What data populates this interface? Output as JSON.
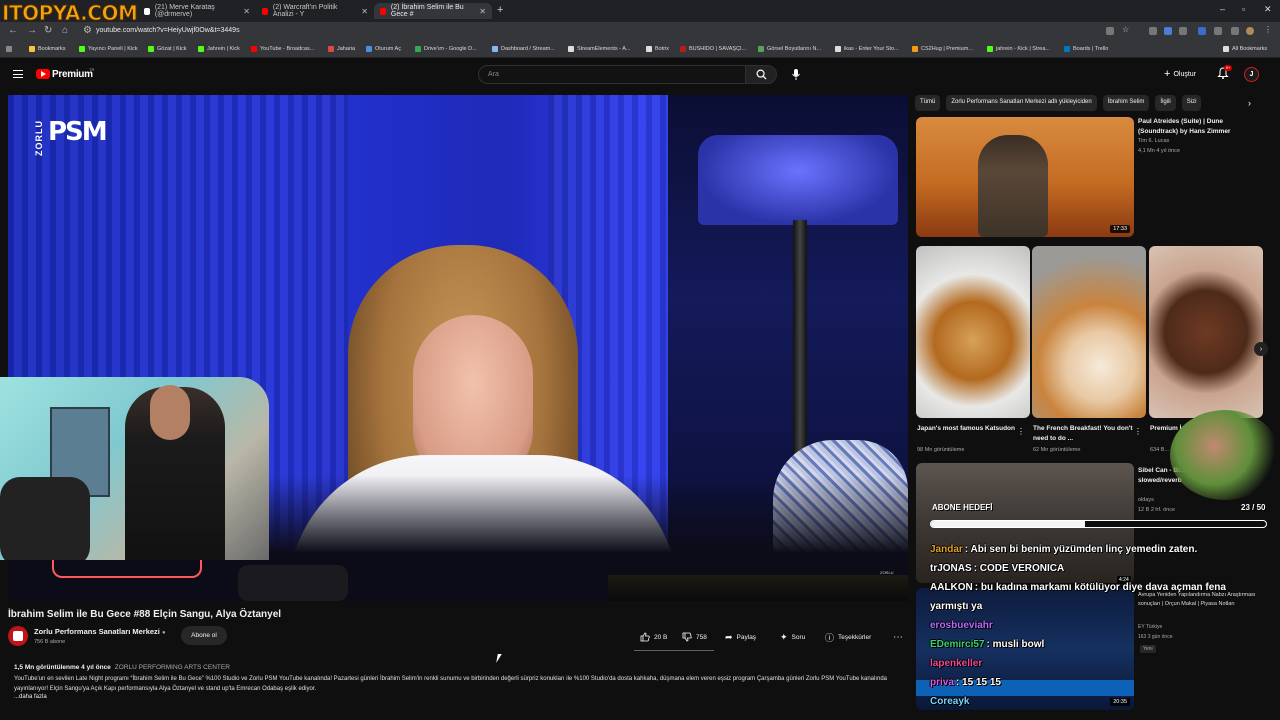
{
  "browser": {
    "logo_text": "ITOPYA.COM",
    "tabs": [
      {
        "label": "(21) Merve Karataş (@drmerve)",
        "color": "#ffffff",
        "active": false
      },
      {
        "label": "(2) Warcraft'ın Politik Analizi - Y",
        "color": "#ff0000",
        "active": false
      },
      {
        "label": "(2) İbrahim Selim ile Bu Gece #",
        "color": "#ff0000",
        "active": true
      }
    ],
    "url": "youtube.com/watch?v=HeiyUwjf0Ow&t=3449s",
    "bookmarks": [
      {
        "label": "Bookmarks",
        "color": "#f5c542"
      },
      {
        "label": "Yayıncı Paneli | Kick",
        "color": "#53fc18"
      },
      {
        "label": "Gözat | Kick",
        "color": "#53fc18"
      },
      {
        "label": "Jahrein | Kick",
        "color": "#53fc18"
      },
      {
        "label": "YouTube - Broadcas...",
        "color": "#ff0000"
      },
      {
        "label": "Jaharia",
        "color": "#e04848"
      },
      {
        "label": "Oturum Aç",
        "color": "#4a90e2"
      },
      {
        "label": "Drive'ım - Google D...",
        "color": "#34a853"
      },
      {
        "label": "Dashboard / Stream...",
        "color": "#8ab4f8"
      },
      {
        "label": "StreamElements - A...",
        "color": "#dddddd"
      },
      {
        "label": "Botrix",
        "color": "#dddddd"
      },
      {
        "label": "BUSHIDO | SAVAŞÇI...",
        "color": "#b71c1c"
      },
      {
        "label": "Görsel Boyutlarını N...",
        "color": "#5aa05a"
      },
      {
        "label": "ikas - Enter Your Sto...",
        "color": "#dddddd"
      },
      {
        "label": "CS2Hug | Premium...",
        "color": "#f39c12"
      },
      {
        "label": "jahrein - Kick | Strea...",
        "color": "#53fc18"
      },
      {
        "label": "Boards | Trello",
        "color": "#0079bf"
      },
      {
        "label": "All Bookmarks",
        "color": "#dddddd"
      }
    ]
  },
  "header": {
    "logo": "Premium",
    "logo_sup": "TR",
    "search_placeholder": "Ara",
    "create_label": "Oluştur",
    "notification_count": "9+",
    "avatar_letter": "J"
  },
  "video": {
    "brand_top": "ZORLU",
    "brand_main": "PSM",
    "watermark": "ZORLU",
    "title": "İbrahim Selim ile Bu Gece #88 Elçin Sangu, Alya Öztanyel",
    "channel": "Zorlu Performans Sanatları Merkezi",
    "subscribers": "756 B abone",
    "subscribe_label": "Abone ol",
    "likes": "20 B",
    "dislikes": "758",
    "share": "Paylaş",
    "ask": "Soru",
    "thanks": "Teşekkürler",
    "views_date": "1,5 Mn görüntülenme  4 yıl önce",
    "venue": "ZORLU PERFORMING ARTS CENTER",
    "description": "YouTube'un en sevilen Late Night programı “İbrahim Selim ile Bu Gece” %100 Studio ve Zorlu PSM YouTube kanalında! Pazartesi günleri İbrahim Selim'in renkli sunumu ve birbirinden değerli sürpriz konukları ile %100 Studio'da dosta kahkaha, düşmana elem veren eşsiz program Çarşamba günleri Zorlu PSM YouTube kanalında yayınlanıyor! Elçin Sangu'ya Açık Kapı performansıyla Alya Öztanyel ve stand up'ta Emrecan Odabaş eşlik ediyor.",
    "more": "...daha fazla"
  },
  "sidebar": {
    "chips": [
      "Tümü",
      "Zorlu Performans Sanatları Merkezi adlı yükleyiciden",
      "İbrahim Selim",
      "İlgili",
      "Sizi"
    ],
    "rec1": {
      "title": "Paul Atreides (Suite) | Dune (Soundtrack) by Hans Zimmer",
      "channel": "Tim 6. Lucas",
      "meta": "4,1 Mn  4 yıl önce",
      "duration": "17:33"
    },
    "shorts": [
      {
        "title": "Japan's most famous Katsudon",
        "views": "98 Mn görüntüleme"
      },
      {
        "title": "The French Breakfast! You don't need to do ...",
        "views": "62 Mn görüntüleme"
      },
      {
        "title": "Premium İsal #Tiramisu",
        "views": "634 B..."
      }
    ],
    "rec2": {
      "title": "Sibel Can - Bi... Has Swaggybark & slowed/reverb",
      "channel": "oldays",
      "meta": "12 B  2 hf. önce",
      "duration": "4:24"
    },
    "rec3": {
      "title": "Avrupa Yeniden Yapılandırma Nabzı Araştırması sonuçları | Orçun Makal | Piyasa Notları",
      "channel": "EY Türkiye",
      "meta": "163  3 gün önce",
      "badge": "Yeni",
      "duration": "20:35"
    }
  },
  "overlay": {
    "goal_label": "ABONE HEDEFİ",
    "goal_count": "23 / 50",
    "goal_progress": 0.46,
    "chat": [
      {
        "user": "Jandar",
        "user_color": "#e0a32b",
        "message": "Abi sen bi benim yüzümden linç yemedin zaten."
      },
      {
        "user": "trJONAS",
        "user_color": "#ffffff",
        "message": "CODE VERONICA"
      },
      {
        "user": "AALKON",
        "user_color": "#ffffff",
        "message": "bu kadına markamı kötülüyor diye dava açman fena"
      },
      {
        "user": "",
        "user_color": "#ffffff",
        "message": "yarmıştı ya"
      },
      {
        "user": "erosbueviahr",
        "user_color": "#b56cff",
        "message": ""
      },
      {
        "user": "EDemirci57",
        "user_color": "#3bd16f",
        "message": "musli bowl"
      },
      {
        "user": "lapenkeller",
        "user_color": "#e84d9a",
        "message": ""
      },
      {
        "user": "priva",
        "user_color": "#d45ce8",
        "message": "15 15 15"
      },
      {
        "user": "Coreayk",
        "user_color": "#7bd3ff",
        "message": ""
      }
    ]
  }
}
